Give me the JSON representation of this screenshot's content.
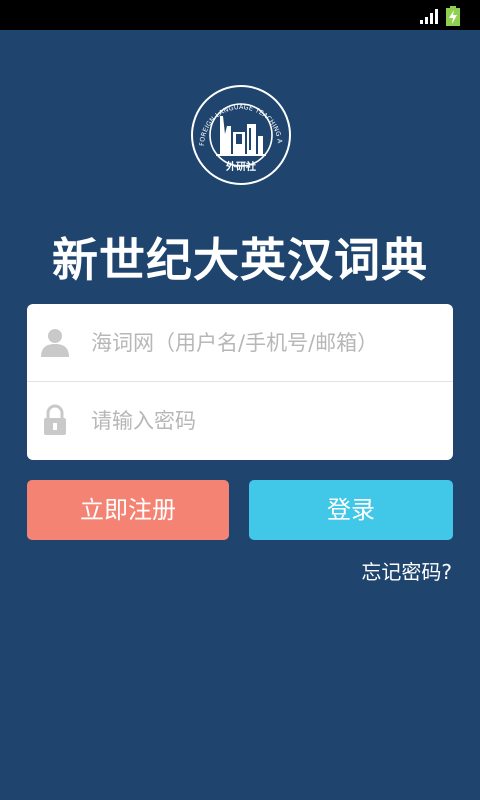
{
  "status_bar": {
    "signal_icon": "signal-strength-icon",
    "battery_icon": "battery-charging-icon"
  },
  "logo": {
    "arc_text": "FOREIGN LANGUAGE TEACHING AND RESEARCH PRESS",
    "name": "外研社"
  },
  "app_title": "新世纪大英汉词典",
  "form": {
    "username": {
      "icon": "user-icon",
      "placeholder": "海词网（用户名/手机号/邮箱）",
      "value": ""
    },
    "password": {
      "icon": "lock-icon",
      "placeholder": "请输入密码",
      "value": ""
    }
  },
  "buttons": {
    "register": "立即注册",
    "login": "登录"
  },
  "forgot_password": "忘记密码?",
  "colors": {
    "background": "#1f456f",
    "register": "#f58373",
    "login": "#41c7e8"
  }
}
